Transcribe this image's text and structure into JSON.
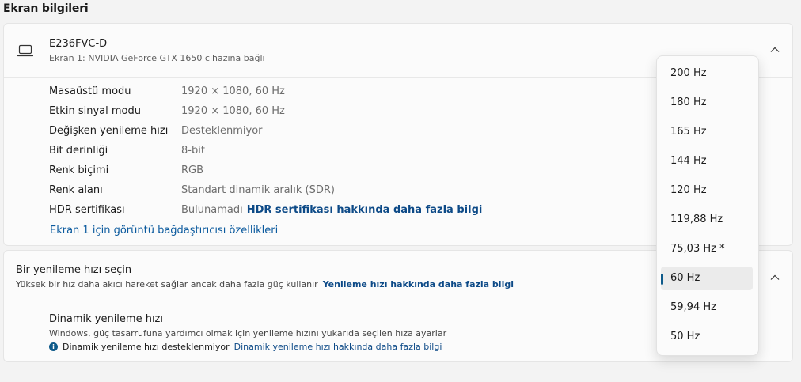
{
  "section_title": "Ekran bilgileri",
  "display": {
    "name": "E236FVC-D",
    "subtitle": "Ekran 1: NVIDIA GeForce GTX 1650 cihazına bağlı",
    "properties": [
      {
        "key": "Masaüstü modu",
        "value": "1920 × 1080, 60 Hz"
      },
      {
        "key": "Etkin sinyal modu",
        "value": "1920 × 1080, 60 Hz"
      },
      {
        "key": "Değişken yenileme hızı",
        "value": "Desteklenmiyor"
      },
      {
        "key": "Bit derinliği",
        "value": "8-bit"
      },
      {
        "key": "Renk biçimi",
        "value": "RGB"
      },
      {
        "key": "Renk alanı",
        "value": "Standart dinamik aralık (SDR)"
      },
      {
        "key": "HDR sertifikası",
        "value": "Bulunamadı",
        "link": "HDR sertifikası hakkında daha fazla bilgi"
      }
    ],
    "adapter_link": "Ekran 1 için görüntü bağdaştırıcısı özellikleri"
  },
  "refresh": {
    "title": "Bir yenileme hızı seçin",
    "subtitle": "Yüksek bir hız daha akıcı hareket sağlar ancak daha fazla güç kullanır",
    "link": "Yenileme hızı hakkında daha fazla bilgi",
    "dynamic_title": "Dinamik yenileme hızı",
    "dynamic_sub": "Windows, güç tasarrufuna yardımcı olmak için yenileme hızını yukarıda seçilen hıza ayarlar",
    "dynamic_info": "Dinamik yenileme hızı desteklenmiyor",
    "dynamic_link": "Dinamik yenileme hızı hakkında daha fazla bilgi",
    "options": [
      "200 Hz",
      "180 Hz",
      "165 Hz",
      "144 Hz",
      "120 Hz",
      "119,88 Hz",
      "75,03 Hz *",
      "60 Hz",
      "59,94 Hz",
      "50 Hz"
    ],
    "selected": "60 Hz"
  },
  "colors": {
    "accent": "#0e5a8a",
    "link": "#0d4a87"
  }
}
